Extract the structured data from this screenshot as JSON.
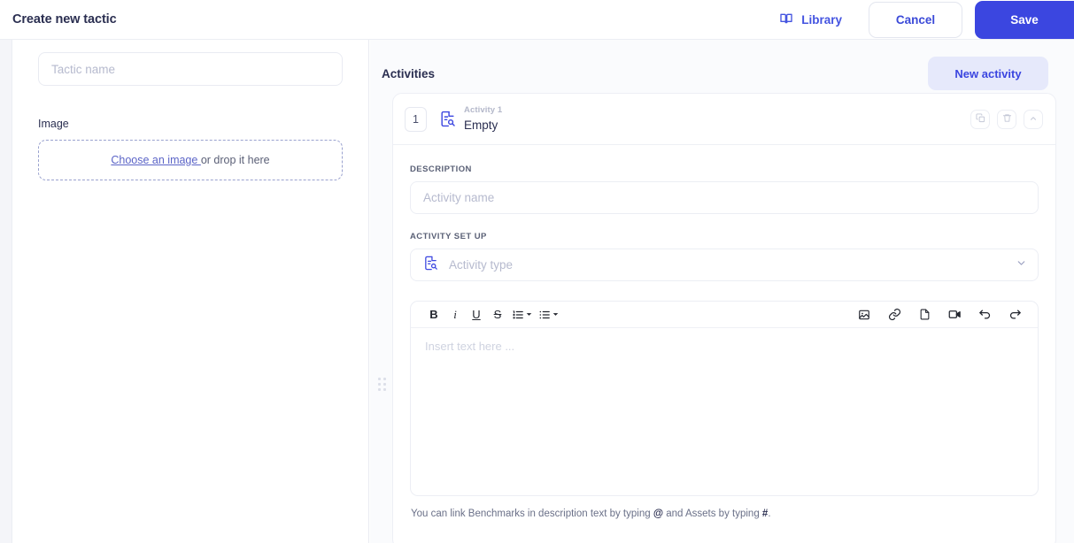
{
  "topbar": {
    "title": "Create new tactic",
    "library_label": "Library",
    "cancel_label": "Cancel",
    "save_label": "Save",
    "library_icon": "book-icon"
  },
  "sidebar": {
    "tactic_name_placeholder": "Tactic name",
    "tactic_name_value": "",
    "image_label": "Image",
    "dropzone_link": "Choose an image ",
    "dropzone_text": "or drop it here"
  },
  "main": {
    "activities_title": "Activities",
    "new_activity_label": "New activity",
    "drag_handle_icon": "grip-dots-icon"
  },
  "activity": {
    "number": "1",
    "type_icon": "document-search-icon",
    "sub_label": "Activity 1",
    "name": "Empty",
    "actions": [
      {
        "icon": "duplicate-icon",
        "name": "duplicate-activity-button"
      },
      {
        "icon": "trash-icon",
        "name": "delete-activity-button"
      },
      {
        "icon": "chevron-up-icon",
        "name": "collapse-activity-button"
      }
    ],
    "description_label": "DESCRIPTION",
    "description_placeholder": "Activity name",
    "description_value": "",
    "setup_label": "ACTIVITY SET UP",
    "activity_type_placeholder": "Activity type",
    "activity_type_value": ""
  },
  "editor": {
    "placeholder": "Insert text here ...",
    "value": "",
    "tools_left": [
      {
        "name": "bold-icon",
        "glyph": "B"
      },
      {
        "name": "italic-icon",
        "glyph": "i"
      },
      {
        "name": "underline-icon",
        "glyph": "U"
      },
      {
        "name": "strikethrough-icon",
        "glyph": "S"
      },
      {
        "name": "ordered-list-icon",
        "glyph": "1."
      },
      {
        "name": "bullet-list-icon",
        "glyph": "•"
      }
    ],
    "tools_right": [
      {
        "name": "image-icon"
      },
      {
        "name": "link-icon"
      },
      {
        "name": "file-icon"
      },
      {
        "name": "video-icon"
      },
      {
        "name": "undo-icon"
      },
      {
        "name": "redo-icon"
      }
    ],
    "hint_part1": "You can link Benchmarks in description text by typing ",
    "hint_at": "@",
    "hint_part2": " and Assets by typing ",
    "hint_hash": "#",
    "hint_part3": "."
  },
  "colors": {
    "accent": "#3b46e0",
    "accent_soft": "#e6e9fb",
    "text": "#2b2f51",
    "muted": "#b6bace",
    "panel_bg": "#fafbfd"
  }
}
